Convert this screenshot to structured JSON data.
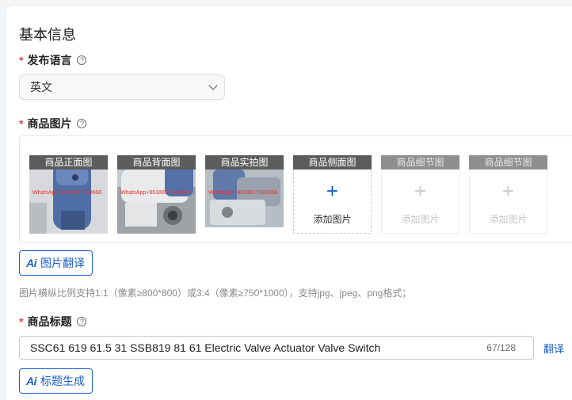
{
  "section": {
    "title": "基本信息"
  },
  "language": {
    "required_mark": "*",
    "label": "发布语言",
    "help_glyph": "?",
    "selected": "英文"
  },
  "images": {
    "required_mark": "*",
    "label": "商品图片",
    "help_glyph": "?",
    "slots": [
      {
        "caption": "商品正面图",
        "state": "filled",
        "watermark": "WhatsApp+8618817040668"
      },
      {
        "caption": "商品背面图",
        "state": "filled",
        "watermark": "WhatsApp+8618817040668"
      },
      {
        "caption": "商品实拍图",
        "state": "filled",
        "watermark": "WhatsApp+8618817040668"
      },
      {
        "caption": "商品侧面图",
        "state": "empty",
        "add_label": "添加图片",
        "plus": "+"
      },
      {
        "caption": "商品细节图",
        "state": "disabled",
        "add_label": "添加图片",
        "plus": "+"
      },
      {
        "caption": "商品细节图",
        "state": "disabled",
        "add_label": "添加图片",
        "plus": "+"
      }
    ],
    "translate_button": {
      "icon_text": "Ai",
      "label": "图片翻译"
    },
    "hint": "图片横纵比例支持1:1（像素≥800*800）或3:4（像素≥750*1000），支持jpg、jpeg、png格式；"
  },
  "title": {
    "required_mark": "*",
    "label": "商品标题",
    "help_glyph": "?",
    "value": "SSC61 619 61.5 31 SSB819 81 61 Electric Valve Actuator Valve Switch",
    "counter": "67/128",
    "translate_link": "翻译",
    "generate_button": {
      "icon_text": "Ai",
      "label": "标题生成"
    }
  },
  "colors": {
    "accent": "#1a5fd0",
    "required": "#e5484d",
    "caption_bg": "#5c5c5c"
  }
}
